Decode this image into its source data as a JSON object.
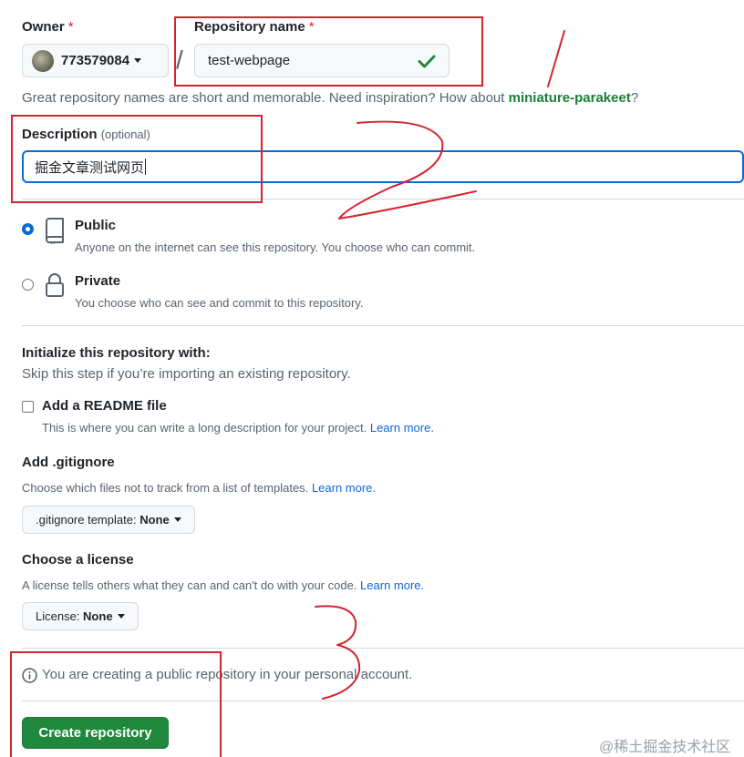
{
  "owner": {
    "label": "Owner",
    "required_mark": "*",
    "value": "773579084"
  },
  "separator": "/",
  "repo_name": {
    "label": "Repository name",
    "required_mark": "*",
    "value": "test-webpage"
  },
  "hint": {
    "text": "Great repository names are short and memorable. Need inspiration? How about ",
    "suggestion": "miniature-parakeet",
    "end": "?"
  },
  "description": {
    "label": "Description",
    "optional": "(optional)",
    "value": "掘金文章测试网页"
  },
  "visibility": {
    "public": {
      "title": "Public",
      "desc": "Anyone on the internet can see this repository. You choose who can commit."
    },
    "private": {
      "title": "Private",
      "desc": "You choose who can see and commit to this repository."
    }
  },
  "init": {
    "title": "Initialize this repository with:",
    "subtitle": "Skip this step if you’re importing an existing repository."
  },
  "readme": {
    "label": "Add a README file",
    "desc": "This is where you can write a long description for your project.",
    "link": "Learn more."
  },
  "gitignore": {
    "title": "Add .gitignore",
    "desc": "Choose which files not to track from a list of templates.",
    "link": "Learn more.",
    "select_label": ".gitignore template:",
    "select_value": "None"
  },
  "license": {
    "title": "Choose a license",
    "desc": "A license tells others what they can and can't do with your code.",
    "link": "Learn more.",
    "select_label": "License:",
    "select_value": "None"
  },
  "notice": "You are creating a public repository in your personal account.",
  "create_button": "Create repository",
  "watermark": "@稀土掘金技术社区",
  "annotations": [
    "1",
    "2",
    "3"
  ],
  "colors": {
    "accent": "#0969da",
    "green": "#1f883d",
    "danger": "#cf222e",
    "annotation_red": "#d4242f"
  }
}
